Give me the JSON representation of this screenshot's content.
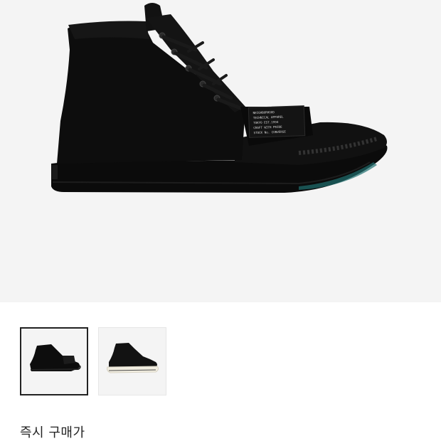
{
  "product": {
    "thumbnails": [
      {
        "name": "black-high-top",
        "selected": true
      },
      {
        "name": "black-high-top-white-sole",
        "selected": false
      }
    ],
    "patch_text": [
      "NEIGHBORHOOD",
      "TECHNICAL APPAREL",
      "TOKYO  EST.1994",
      "CRAFT WITH PRIDE",
      "STOCK No. CONVERSE"
    ]
  },
  "purchase": {
    "instant_buy_label": "즉시 구매가"
  },
  "colors": {
    "hero_bg": "#f4f4f4",
    "selected_border": "#222222",
    "thumb_border": "#e6e6e6",
    "text": "#222222"
  }
}
